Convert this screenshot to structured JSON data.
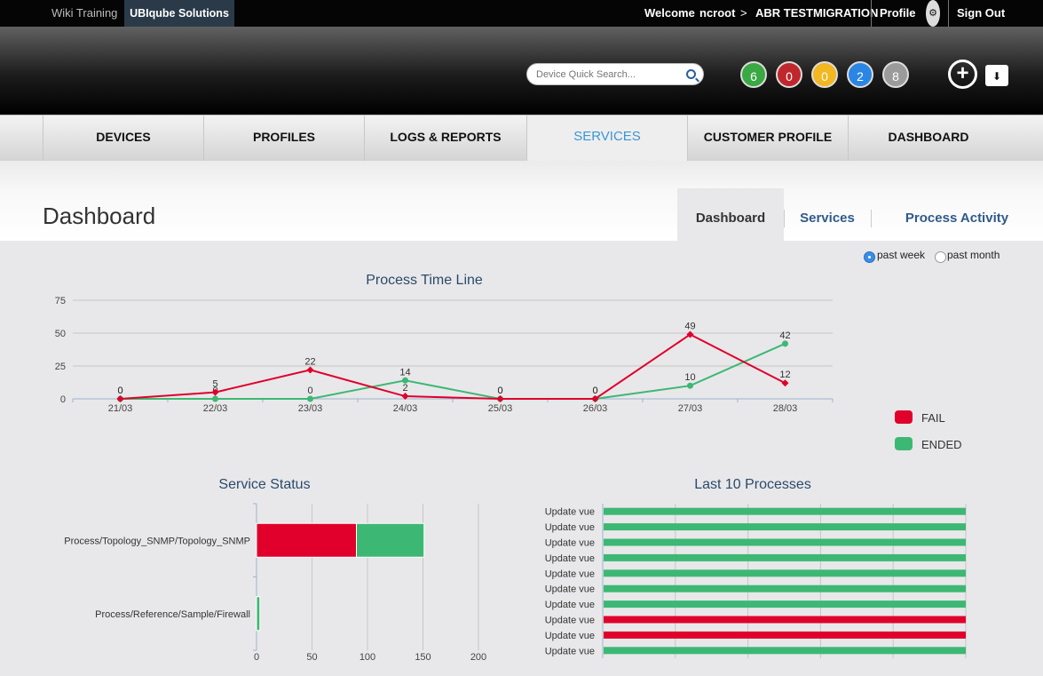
{
  "topbar": {
    "wiki_training": "Wiki Training",
    "org": "UBIqube Solutions",
    "welcome": "Welcome",
    "user": "ncroot",
    "arrow": ">",
    "tenant": "ABR TESTMIGRATION",
    "profile": "Profile",
    "sign_out": "Sign Out",
    "gear_icon": "gear-icon"
  },
  "header": {
    "search_placeholder": "Device Quick Search...",
    "badges": [
      {
        "value": "6",
        "color": "#3aa843"
      },
      {
        "value": "0",
        "color": "#c0272d"
      },
      {
        "value": "0",
        "color": "#f2b721"
      },
      {
        "value": "2",
        "color": "#2b86e3"
      },
      {
        "value": "8",
        "color": "#9b9b9b"
      }
    ],
    "add_icon": "add-circle-icon",
    "folder_icon": "folder-download-icon"
  },
  "nav": [
    {
      "label": "DEVICES"
    },
    {
      "label": "PROFILES"
    },
    {
      "label": "LOGS & REPORTS"
    },
    {
      "label": "SERVICES",
      "active": true
    },
    {
      "label": "CUSTOMER PROFILE"
    },
    {
      "label": "DASHBOARD"
    }
  ],
  "page": {
    "title": "Dashboard",
    "subtabs": [
      {
        "label": "Dashboard",
        "active": true
      },
      {
        "label": "Services"
      },
      {
        "label": "Process Activity"
      }
    ],
    "range": {
      "week": "past week",
      "month": "past month",
      "selected": "week"
    }
  },
  "colors": {
    "fail": "#e0002b",
    "ended": "#3db874"
  },
  "chart_data": [
    {
      "type": "line",
      "title": "Process Time Line",
      "x": [
        "21/03",
        "22/03",
        "23/03",
        "24/03",
        "25/03",
        "26/03",
        "27/03",
        "28/03"
      ],
      "ylim": [
        0,
        75
      ],
      "yticks": [
        0,
        25,
        50,
        75
      ],
      "grid": true,
      "legend": "right",
      "series": [
        {
          "name": "FAIL",
          "values": [
            0,
            5,
            22,
            2,
            0,
            0,
            49,
            12
          ],
          "color": "#e0002b",
          "marker": "diamond"
        },
        {
          "name": "ENDED",
          "values": [
            0,
            0,
            0,
            14,
            0,
            0,
            10,
            42
          ],
          "color": "#3db874",
          "marker": "circle"
        }
      ]
    },
    {
      "type": "bar",
      "orientation": "horizontal",
      "stacked": true,
      "title": "Service Status",
      "categories": [
        "Process/Topology_SNMP/Topology_SNMP",
        "Process/Reference/Sample/Firewall"
      ],
      "xlim": [
        0,
        200
      ],
      "xticks": [
        0,
        50,
        100,
        150,
        200
      ],
      "series": [
        {
          "name": "FAIL",
          "values": [
            90,
            0
          ],
          "color": "#e0002b"
        },
        {
          "name": "ENDED",
          "values": [
            61,
            3
          ],
          "color": "#3db874"
        }
      ]
    },
    {
      "type": "bar",
      "orientation": "horizontal",
      "title": "Last 10 Processes",
      "categories": [
        "Update vue",
        "Update vue",
        "Update vue",
        "Update vue",
        "Update vue",
        "Update vue",
        "Update vue",
        "Update vue",
        "Update vue",
        "Update vue"
      ],
      "status": [
        "ENDED",
        "ENDED",
        "ENDED",
        "ENDED",
        "ENDED",
        "ENDED",
        "ENDED",
        "FAIL",
        "FAIL",
        "ENDED"
      ],
      "values": [
        1,
        1,
        1,
        1,
        1,
        1,
        1,
        1,
        1,
        1
      ]
    }
  ]
}
